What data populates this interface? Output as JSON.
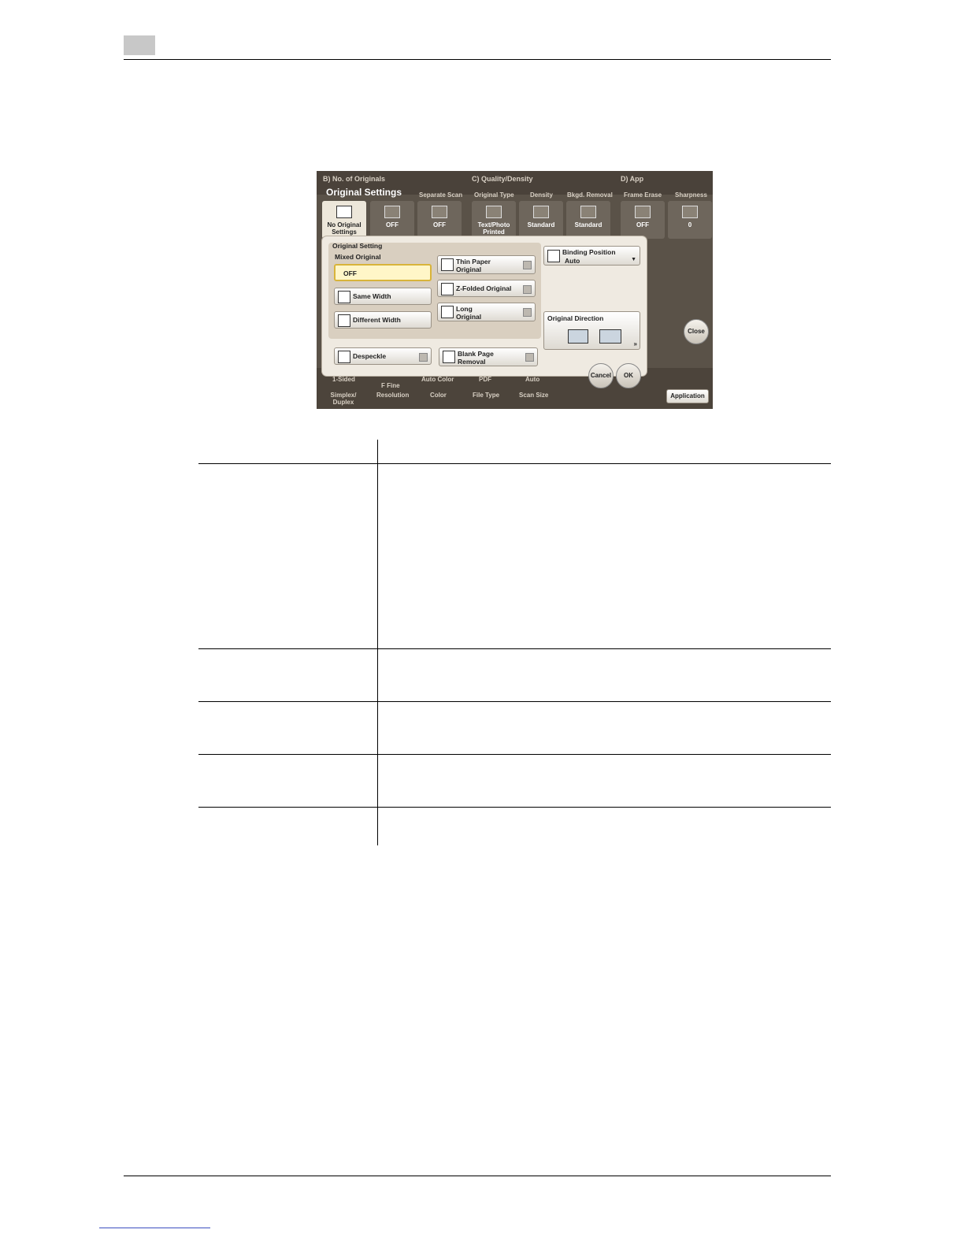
{
  "screenshot": {
    "sections": [
      "B)   No. of Originals",
      "C)   Quality/Density",
      "D)   App"
    ],
    "dialog_title": "Original Settings",
    "columns": [
      "Separate Scan",
      "Original Type",
      "Density",
      "Bkgd. Removal",
      "Frame Erase",
      "Sharpness"
    ],
    "tiles": [
      {
        "label": "No Original Settings"
      },
      {
        "label": "OFF"
      },
      {
        "label": "OFF"
      },
      {
        "label": "Text/Photo Printed"
      },
      {
        "label": "Standard"
      },
      {
        "label": "Standard"
      },
      {
        "label": "OFF"
      },
      {
        "label": "0"
      }
    ],
    "original_setting_label": "Original Setting",
    "mixed_original_label": "Mixed Original",
    "mixed_options": [
      "OFF",
      "Same Width",
      "Different Width"
    ],
    "paper_options": [
      "Thin Paper Original",
      "Z-Folded Original",
      "Long Original"
    ],
    "despeckle": "Despeckle",
    "blank_page_removal": "Blank Page Removal",
    "binding_position": {
      "label": "Binding Position",
      "value": "Auto"
    },
    "original_direction": "Original Direction",
    "close_label": "Close",
    "cancel_label": "Cancel",
    "ok_label": "OK",
    "bottom_values": [
      "1-Sided",
      "F Fine",
      "Auto Color",
      "PDF",
      "Auto"
    ],
    "bottom_labels": [
      "Simplex/ Duplex",
      "Resolution",
      "Color",
      "File Type",
      "Scan Size"
    ],
    "application_label": "Application"
  }
}
